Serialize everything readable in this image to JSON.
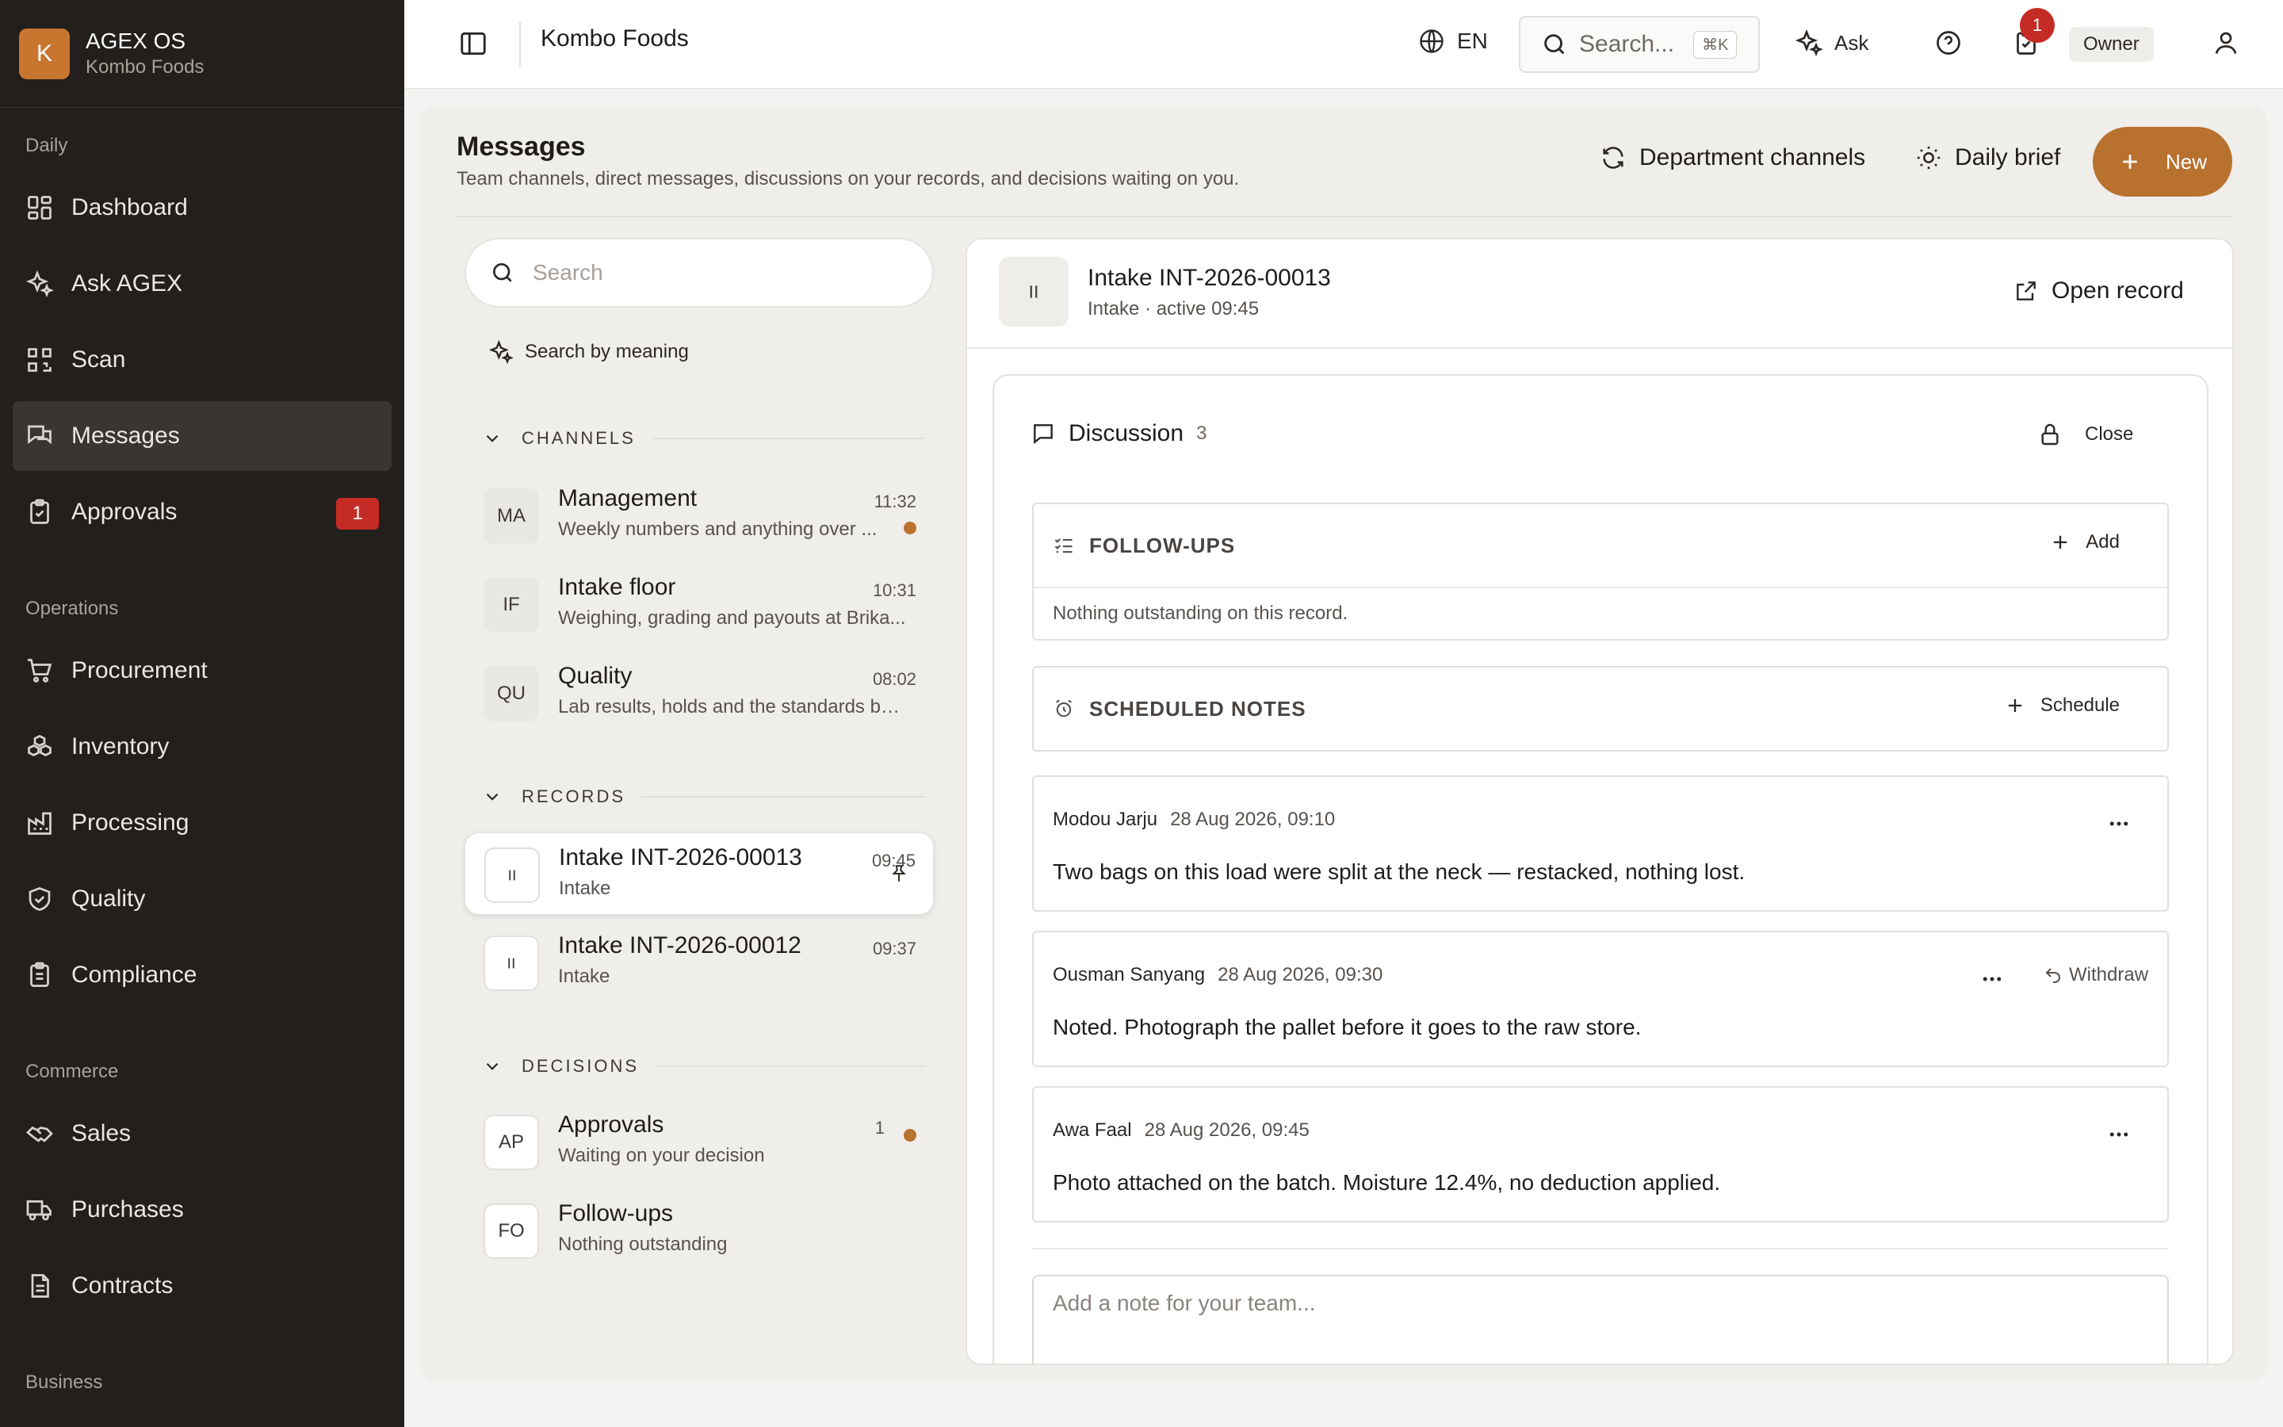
{
  "brand": {
    "logo_letter": "K",
    "name": "AGEX OS",
    "org": "Kombo Foods"
  },
  "sidebar": {
    "groups": [
      {
        "label": "Daily",
        "items": [
          {
            "label": "Dashboard",
            "icon": "dashboard-icon"
          },
          {
            "label": "Ask AGEX",
            "icon": "sparkles-icon"
          },
          {
            "label": "Scan",
            "icon": "qr-scan-icon"
          },
          {
            "label": "Messages",
            "icon": "messages-icon",
            "active": true
          },
          {
            "label": "Approvals",
            "icon": "clipboard-check-icon",
            "badge": "1"
          }
        ]
      },
      {
        "label": "Operations",
        "items": [
          {
            "label": "Procurement",
            "icon": "cart-icon"
          },
          {
            "label": "Inventory",
            "icon": "boxes-icon"
          },
          {
            "label": "Processing",
            "icon": "factory-icon"
          },
          {
            "label": "Quality",
            "icon": "shield-check-icon"
          },
          {
            "label": "Compliance",
            "icon": "clipboard-list-icon"
          }
        ]
      },
      {
        "label": "Commerce",
        "items": [
          {
            "label": "Sales",
            "icon": "handshake-icon"
          },
          {
            "label": "Purchases",
            "icon": "truck-icon"
          },
          {
            "label": "Contracts",
            "icon": "document-icon"
          }
        ]
      },
      {
        "label": "Business",
        "items": []
      }
    ]
  },
  "topbar": {
    "title": "Kombo Foods",
    "language": "EN",
    "search_placeholder": "Search...",
    "search_shortcut": "⌘K",
    "ask_label": "Ask",
    "tasks_badge": "1",
    "role": "Owner"
  },
  "page": {
    "title": "Messages",
    "subtitle": "Team channels, direct messages, discussions on your records, and decisions waiting on you.",
    "department_channels": "Department channels",
    "daily_brief": "Daily brief",
    "new_label": "New"
  },
  "list": {
    "search_placeholder": "Search",
    "search_by_meaning": "Search by meaning",
    "sections": {
      "channels": "CHANNELS",
      "records": "RECORDS",
      "decisions": "DECISIONS"
    },
    "channels": [
      {
        "initials": "MA",
        "title": "Management",
        "time": "11:32",
        "subtitle": "Weekly numbers and anything over ...",
        "unread": true
      },
      {
        "initials": "IF",
        "title": "Intake floor",
        "time": "10:31",
        "subtitle": "Weighing, grading and payouts at Brika...",
        "unread": false
      },
      {
        "initials": "QU",
        "title": "Quality",
        "time": "08:02",
        "subtitle": "Lab results, holds and the standards bu...",
        "unread": false
      }
    ],
    "records": [
      {
        "title": "Intake INT-2026-00013",
        "time": "09:45",
        "subtitle": "Intake",
        "selected": true
      },
      {
        "title": "Intake INT-2026-00012",
        "time": "09:37",
        "subtitle": "Intake",
        "selected": false
      }
    ],
    "decisions": [
      {
        "initials": "AP",
        "title": "Approvals",
        "count": "1",
        "subtitle": "Waiting on your decision",
        "unread": true
      },
      {
        "initials": "FO",
        "title": "Follow-ups",
        "count": "",
        "subtitle": "Nothing outstanding",
        "unread": false
      }
    ]
  },
  "detail": {
    "title": "Intake INT-2026-00013",
    "subtitle": "Intake · active 09:45",
    "open_record": "Open record",
    "discussion": {
      "label": "Discussion",
      "count": "3",
      "close_label": "Close"
    },
    "followups": {
      "title": "FOLLOW-UPS",
      "action": "Add",
      "empty": "Nothing outstanding on this record."
    },
    "scheduled": {
      "title": "SCHEDULED NOTES",
      "action": "Schedule"
    },
    "messages": [
      {
        "author": "Modou Jarju",
        "date": "28 Aug 2026, 09:10",
        "body": "Two bags on this load were split at the neck — restacked, nothing lost.",
        "withdraw": ""
      },
      {
        "author": "Ousman Sanyang",
        "date": "28 Aug 2026, 09:30",
        "body": "Noted. Photograph the pallet before it goes to the raw store.",
        "withdraw": "Withdraw"
      },
      {
        "author": "Awa Faal",
        "date": "28 Aug 2026, 09:45",
        "body": "Photo attached on the batch. Moisture 12.4%, no deduction applied.",
        "withdraw": ""
      }
    ],
    "compose_placeholder": "Add a note for your team..."
  },
  "colors": {
    "accent": "#b8712e",
    "sidebar_bg": "#221f1c",
    "badge_red": "#c42b24"
  }
}
